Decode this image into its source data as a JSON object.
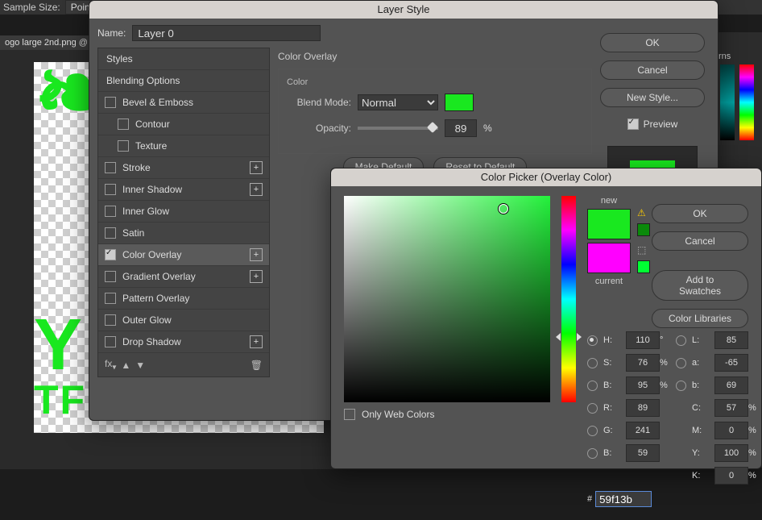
{
  "topbar": {
    "sample_size_label": "Sample Size:",
    "sample_mode": "Point"
  },
  "tab": {
    "filename": "ogo large 2nd.png @"
  },
  "layer_style": {
    "title": "Layer Style",
    "name_label": "Name:",
    "name_value": "Layer 0",
    "styles_title": "Styles",
    "blending_options": "Blending Options",
    "items": [
      {
        "label": "Bevel & Emboss",
        "checked": false,
        "add": false
      },
      {
        "label": "Contour",
        "checked": false,
        "add": false,
        "indent": true
      },
      {
        "label": "Texture",
        "checked": false,
        "add": false,
        "indent": true
      },
      {
        "label": "Stroke",
        "checked": false,
        "add": true
      },
      {
        "label": "Inner Shadow",
        "checked": false,
        "add": true
      },
      {
        "label": "Inner Glow",
        "checked": false,
        "add": false
      },
      {
        "label": "Satin",
        "checked": false,
        "add": false
      },
      {
        "label": "Color Overlay",
        "checked": true,
        "add": true,
        "active": true
      },
      {
        "label": "Gradient Overlay",
        "checked": false,
        "add": true
      },
      {
        "label": "Pattern Overlay",
        "checked": false,
        "add": false
      },
      {
        "label": "Outer Glow",
        "checked": false,
        "add": false
      },
      {
        "label": "Drop Shadow",
        "checked": false,
        "add": true
      }
    ],
    "panel_title": "Color Overlay",
    "color_section": "Color",
    "blend_mode_label": "Blend Mode:",
    "blend_mode_value": "Normal",
    "overlay_color": "#19e81f",
    "opacity_label": "Opacity:",
    "opacity_value": "89",
    "opacity_unit": "%",
    "make_default": "Make Default",
    "reset_default": "Reset to Default",
    "btn_ok": "OK",
    "btn_cancel": "Cancel",
    "btn_new_style": "New Style...",
    "preview_label": "Preview"
  },
  "color_picker": {
    "title": "Color Picker (Overlay Color)",
    "new_label": "new",
    "current_label": "current",
    "new_color": "#19e81f",
    "current_color": "#ff00ff",
    "only_web": "Only Web Colors",
    "btn_ok": "OK",
    "btn_cancel": "Cancel",
    "btn_add_swatches": "Add to Swatches",
    "btn_libraries": "Color Libraries",
    "values": {
      "H": "110",
      "H_unit": "°",
      "S": "76",
      "S_unit": "%",
      "B": "95",
      "B_unit": "%",
      "L": "85",
      "a": "-65",
      "b2": "69",
      "R": "89",
      "G": "241",
      "Bb": "59",
      "C": "57",
      "C_unit": "%",
      "M": "0",
      "M_unit": "%",
      "Y": "100",
      "Y_unit": "%",
      "K": "0",
      "K_unit": "%",
      "hex": "59f13b"
    },
    "labels": {
      "H": "H:",
      "S": "S:",
      "B": "B:",
      "L": "L:",
      "a": "a:",
      "b": "b:",
      "R": "R:",
      "G": "G:",
      "Bb": "B:",
      "C": "C:",
      "M": "M:",
      "Y": "Y:",
      "K": "K:",
      "hash": "#"
    }
  },
  "right_panel": {
    "tab_label": "rns"
  }
}
